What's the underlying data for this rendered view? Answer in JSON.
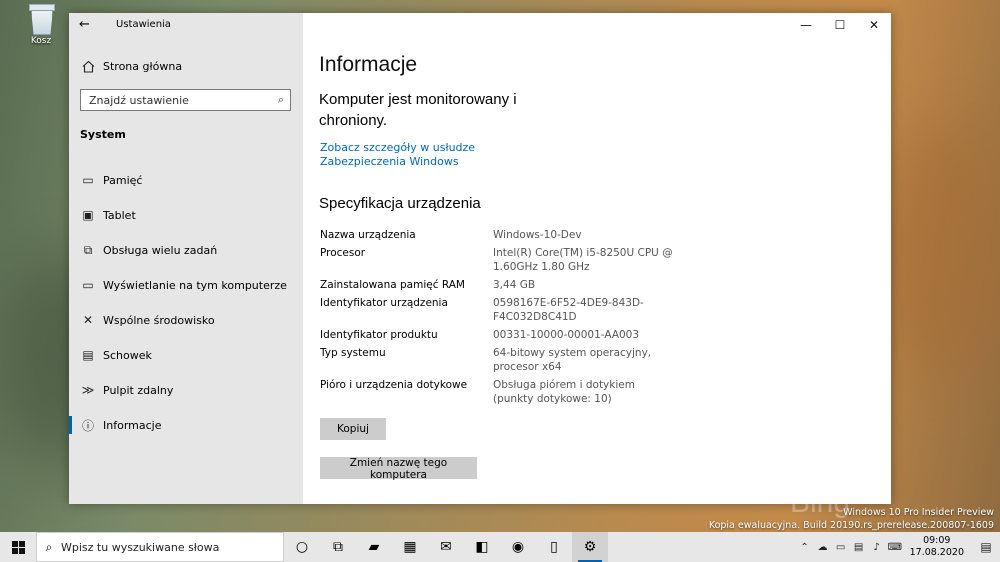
{
  "desktop": {
    "recycle_bin_label": "Kosz",
    "watermark_line1": "Windows 10 Pro Insider Preview",
    "watermark_line2": "Kopia ewaluacyjna. Build 20190.rs_prerelease.200807-1609",
    "bing_text": "Bing"
  },
  "window": {
    "title": "Ustawienia",
    "back_icon": "arrow-left-icon",
    "controls": {
      "minimize": "—",
      "maximize": "☐",
      "close": "✕"
    }
  },
  "sidebar": {
    "home_label": "Strona główna",
    "search_placeholder": "Znajdź ustawienie",
    "section_label": "System",
    "items": [
      {
        "label": "Pamięć",
        "icon": "storage-icon",
        "glyph": "▭"
      },
      {
        "label": "Tablet",
        "icon": "tablet-icon",
        "glyph": "▣"
      },
      {
        "label": "Obsługa wielu zadań",
        "icon": "multitasking-icon",
        "glyph": "⧉"
      },
      {
        "label": "Wyświetlanie na tym komputerze",
        "icon": "project-icon",
        "glyph": "▭"
      },
      {
        "label": "Wspólne środowisko",
        "icon": "shared-experiences-icon",
        "glyph": "✕"
      },
      {
        "label": "Schowek",
        "icon": "clipboard-icon",
        "glyph": "▤"
      },
      {
        "label": "Pulpit zdalny",
        "icon": "remote-desktop-icon",
        "glyph": "≫"
      },
      {
        "label": "Informacje",
        "icon": "info-icon",
        "glyph": "ⓘ",
        "active": true
      }
    ]
  },
  "main": {
    "title": "Informacje",
    "status_text": "Komputer jest monitorowany i chroniony.",
    "security_link": "Zobacz szczegóły w usłudze Zabezpieczenia Windows",
    "spec_heading": "Specyfikacja urządzenia",
    "specs": [
      {
        "key": "Nazwa urządzenia",
        "value": "Windows-10-Dev"
      },
      {
        "key": "Procesor",
        "value": "Intel(R) Core(TM) i5-8250U CPU @ 1.60GHz   1.80 GHz"
      },
      {
        "key": "Zainstalowana pamięć RAM",
        "value": "3,44 GB"
      },
      {
        "key": "Identyfikator urządzenia",
        "value": "0598167E-6F52-4DE9-843D-F4C032D8C41D"
      },
      {
        "key": "Identyfikator produktu",
        "value": "00331-10000-00001-AA003"
      },
      {
        "key": "Typ systemu",
        "value": "64-bitowy system operacyjny, procesor x64"
      },
      {
        "key": "Pióro i urządzenia dotykowe",
        "value": "Obsługa piórem i dotykiem (punkty dotykowe: 10)"
      }
    ],
    "copy_button": "Kopiuj",
    "rename_button": "Zmień nazwę tego komputera"
  },
  "taskbar": {
    "search_placeholder": "Wpisz tu wyszukiwane słowa",
    "apps": [
      {
        "icon": "cortana-icon",
        "glyph": "○"
      },
      {
        "icon": "task-view-icon",
        "glyph": "⧉"
      },
      {
        "icon": "file-explorer-icon",
        "glyph": "▰"
      },
      {
        "icon": "store-icon",
        "glyph": "▦"
      },
      {
        "icon": "mail-icon",
        "glyph": "✉"
      },
      {
        "icon": "office-icon",
        "glyph": "◧"
      },
      {
        "icon": "edge-canary-icon",
        "glyph": "◉"
      },
      {
        "icon": "phone-icon",
        "glyph": "▯"
      },
      {
        "icon": "settings-icon",
        "glyph": "⚙",
        "active": true
      }
    ],
    "time": "09:09",
    "date": "17.08.2020"
  },
  "colors": {
    "accent": "#0063b1",
    "link": "#0067b8",
    "sidebar_bg": "#e6e6e6",
    "button_bg": "#cccccc"
  }
}
